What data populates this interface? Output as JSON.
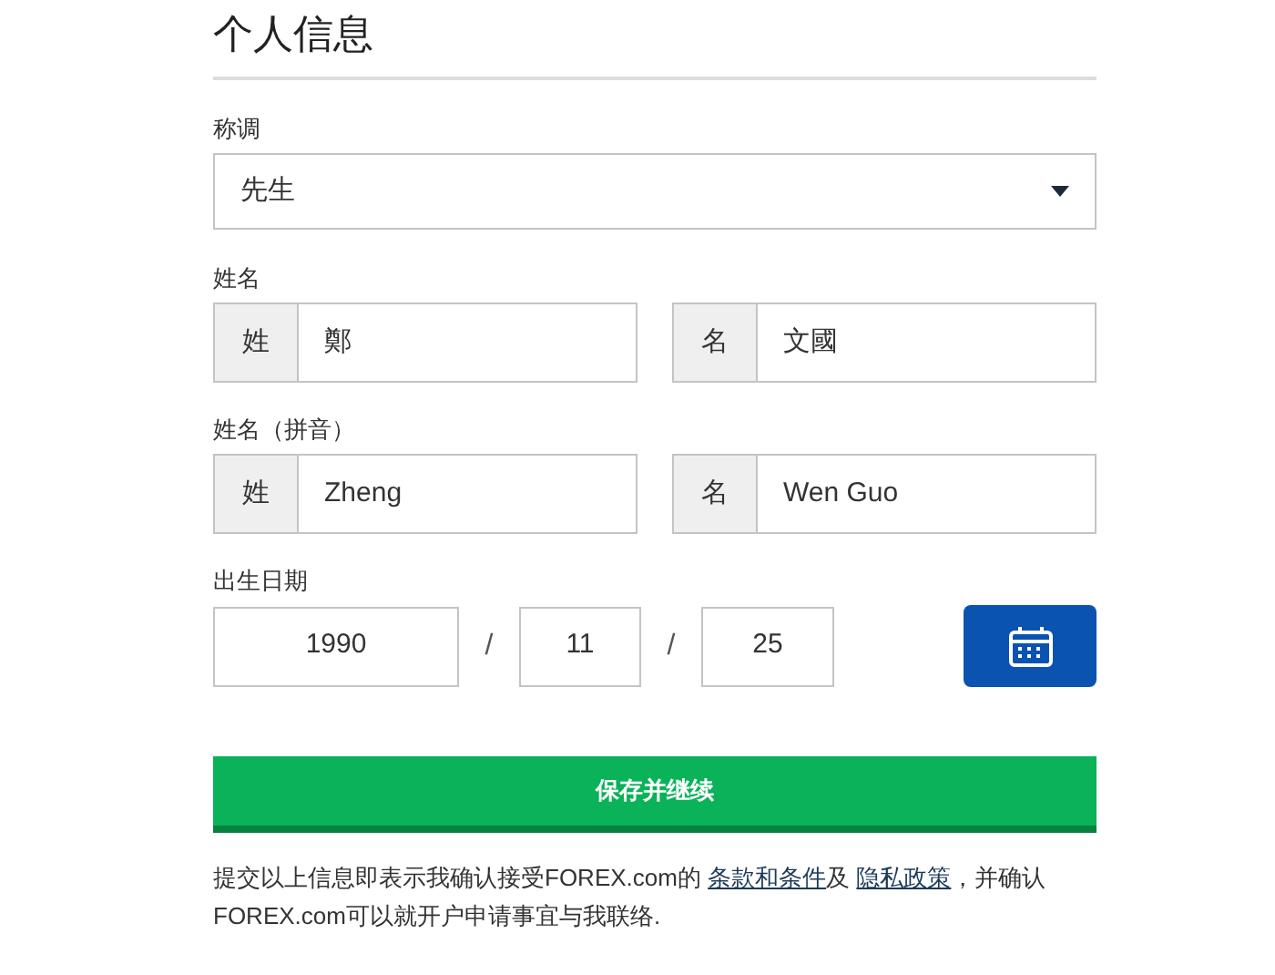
{
  "title": "个人信息",
  "salutation": {
    "label": "称调",
    "value": "先生"
  },
  "name": {
    "label": "姓名",
    "fields": [
      {
        "prefix": "姓",
        "value": "鄭"
      },
      {
        "prefix": "名",
        "value": "文國"
      }
    ]
  },
  "name_pinyin": {
    "label": "姓名（拼音）",
    "fields": [
      {
        "prefix": "姓",
        "value": "Zheng"
      },
      {
        "prefix": "名",
        "value": "Wen Guo"
      }
    ]
  },
  "birth_date": {
    "label": "出生日期",
    "year": "1990",
    "separator_1": "/",
    "month": "11",
    "separator_2": "/",
    "day": "25"
  },
  "submit_button": "保存并继续",
  "legal": {
    "text_before": "提交以上信息即表示我确认接受FOREX.com的 ",
    "terms_link": "条款和条件",
    "middle": "及 ",
    "privacy_link": "隐私政策",
    "text_after": "，并确认FOREX.com可以就开户申请事宜与我联络."
  }
}
